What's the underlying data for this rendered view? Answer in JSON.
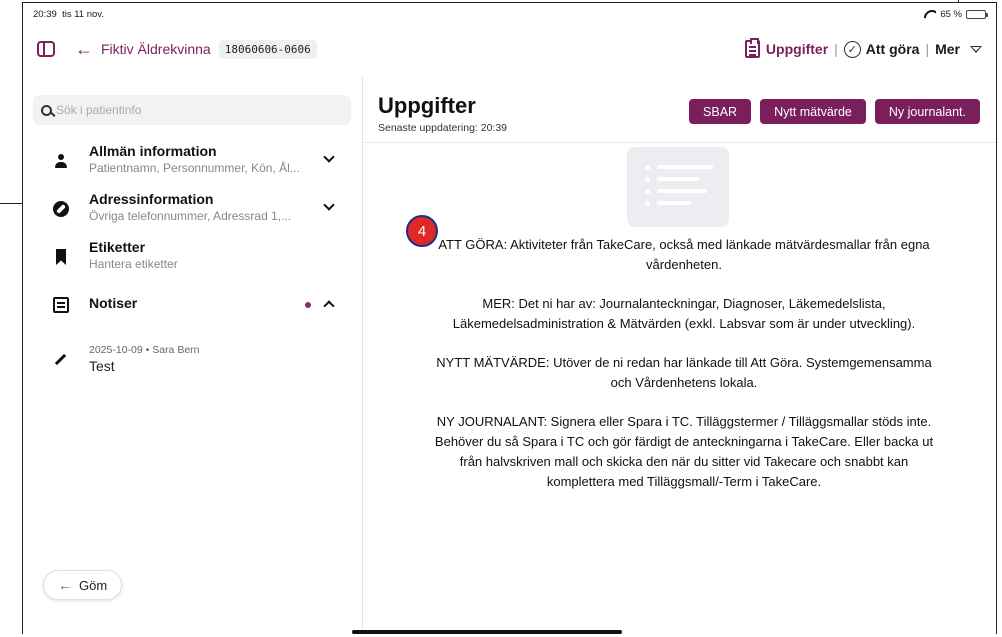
{
  "status_bar": {
    "time": "20:39",
    "date": "tis 11 nov.",
    "battery": "65 %",
    "battery_level": 0.65
  },
  "topbar": {
    "patient_name": "Fiktiv Äldrekvinna",
    "patient_id": "18060606-0606",
    "nav": {
      "uppgifter": "Uppgifter",
      "att_gora": "Att göra",
      "mer": "Mer"
    }
  },
  "sidebar": {
    "search_placeholder": "Sök i patientinfo",
    "items": [
      {
        "title": "Allmän information",
        "subtitle": "Patientnamn, Personnummer, Kön, Ål..."
      },
      {
        "title": "Adressinformation",
        "subtitle": "Övriga telefonnummer, Adressrad 1,..."
      },
      {
        "title": "Etiketter",
        "subtitle": "Hantera etiketter"
      },
      {
        "title": "Notiser",
        "subtitle": ""
      }
    ],
    "note": {
      "meta": "2025-10-09 • Sara Bern",
      "text": "Test"
    },
    "hide_label": "Göm"
  },
  "content": {
    "title": "Uppgifter",
    "last_update": "Senaste uppdatering: 20:39",
    "buttons": {
      "sbar": "SBAR",
      "new_value": "Nytt mätvärde",
      "new_note": "Ny journalant."
    },
    "step_number": "4",
    "help": [
      "ATT GÖRA: Aktiviteter från TakeCare, också med länkade mätvärdesmallar från egna vårdenheten.",
      "MER: Det ni har av: Journalanteckningar, Diagnoser, Läkemedelslista, Läkemedelsadministration & Mätvärden (exkl. Labsvar som är under utveckling).",
      "NYTT MÄTVÄRDE: Utöver de ni redan har länkade till Att Göra. Systemgemensamma och Vårdenhetens lokala.",
      "NY JOURNALANT: Signera eller Spara i TC. Tilläggstermer / Tilläggsmallar stöds inte. Behöver du så Spara i TC och gör färdigt de anteckningarna i TakeCare. Eller backa ut från halvskriven mall och skicka den när du sitter vid Takecare och snabbt kan komplettera med Tilläggsmall/-Term i TakeCare."
    ]
  },
  "colors": {
    "accent": "#7a1f5c",
    "badge": "#e02828"
  }
}
